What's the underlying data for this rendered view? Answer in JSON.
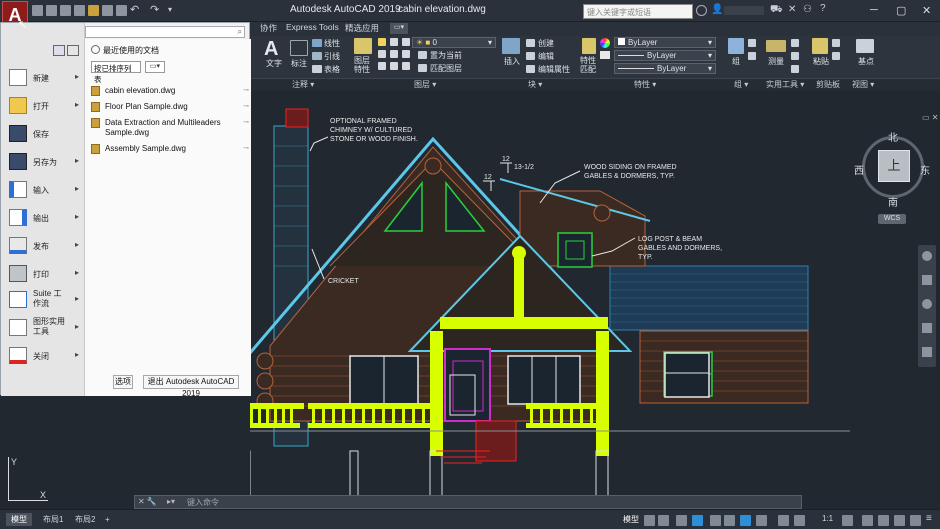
{
  "app": {
    "title": "Autodesk AutoCAD 2019",
    "filename": "cabin elevation.dwg",
    "logo": "A"
  },
  "search": {
    "placeholder": "键入关键字或短语"
  },
  "window_controls": [
    "─",
    "▢",
    "✕"
  ],
  "ribbon_tabs": [
    "协作",
    "Express Tools",
    "精选应用"
  ],
  "ribbon": {
    "text_label": "文字",
    "dim_label": "标注",
    "linear": "线性",
    "leader": "引线",
    "table": "表格",
    "layer_props": "图层\n特性",
    "layer_current_value": "0",
    "set_current": "置为当前",
    "match_layer": "匹配图层",
    "insert": "插入",
    "create": "创建",
    "edit": "编辑",
    "edit_attr": "编辑属性",
    "match_props": "特性\n匹配",
    "bylayer_1": "ByLayer",
    "bylayer_2": "ByLayer",
    "bylayer_3": "ByLayer",
    "group": "组",
    "measure": "测量",
    "paste": "粘贴",
    "base": "基点"
  },
  "panel_labels": [
    "注释 ▾",
    "图层 ▾",
    "块 ▾",
    "特性 ▾",
    "组 ▾",
    "实用工具 ▾",
    "剪贴板",
    "视图 ▾"
  ],
  "app_menu": {
    "search_placeholder": "",
    "items": [
      {
        "label": "新建",
        "arrow": "▸"
      },
      {
        "label": "打开",
        "arrow": "▸"
      },
      {
        "label": "保存",
        "arrow": ""
      },
      {
        "label": "另存为",
        "arrow": "▸"
      },
      {
        "label": "输入",
        "arrow": "▸"
      },
      {
        "label": "输出",
        "arrow": "▸"
      },
      {
        "label": "发布",
        "arrow": "▸"
      },
      {
        "label": "打印",
        "arrow": "▸"
      },
      {
        "label": "Suite 工作流",
        "arrow": "▸"
      },
      {
        "label": "图形实用工具",
        "arrow": "▸"
      },
      {
        "label": "关闭",
        "arrow": "▸"
      }
    ],
    "recent_title": "最近使用的文档",
    "sort_dropdown": "按已排序列表",
    "recent_docs": [
      "cabin elevation.dwg",
      "Floor Plan Sample.dwg",
      "Data Extraction and Multileaders Sample.dwg",
      "Assembly Sample.dwg"
    ],
    "options_button": "选项",
    "exit_button": "退出 Autodesk AutoCAD 2019"
  },
  "drawing": {
    "annotations": [
      "OPTIONAL FRAMED",
      "CHIMNEY W/ CULTURED",
      "STONE OR WOOD FINISH.",
      "WOOD SIDING ON FRAMED",
      "GABLES & DORMERS, TYP.",
      "LOG POST & BEAM",
      "GABLES AND DORMERS,",
      "TYP.",
      "CRICKET",
      "12",
      "13-1/2",
      "12"
    ]
  },
  "viewcube": {
    "north": "北",
    "south": "南",
    "east": "东",
    "west": "西",
    "top": "上",
    "wcs": "WCS"
  },
  "command_line": {
    "placeholder": "键入命令"
  },
  "status": {
    "layout_tabs": [
      "模型",
      "布局1",
      "布局2",
      "+"
    ],
    "model_label": "模型",
    "scale": "1:1"
  },
  "colors": {
    "accent_red": "#b51d1d",
    "drawing_bg": "#212830",
    "yellow_green": "#d8ff00",
    "cyan": "#00c8d8"
  }
}
